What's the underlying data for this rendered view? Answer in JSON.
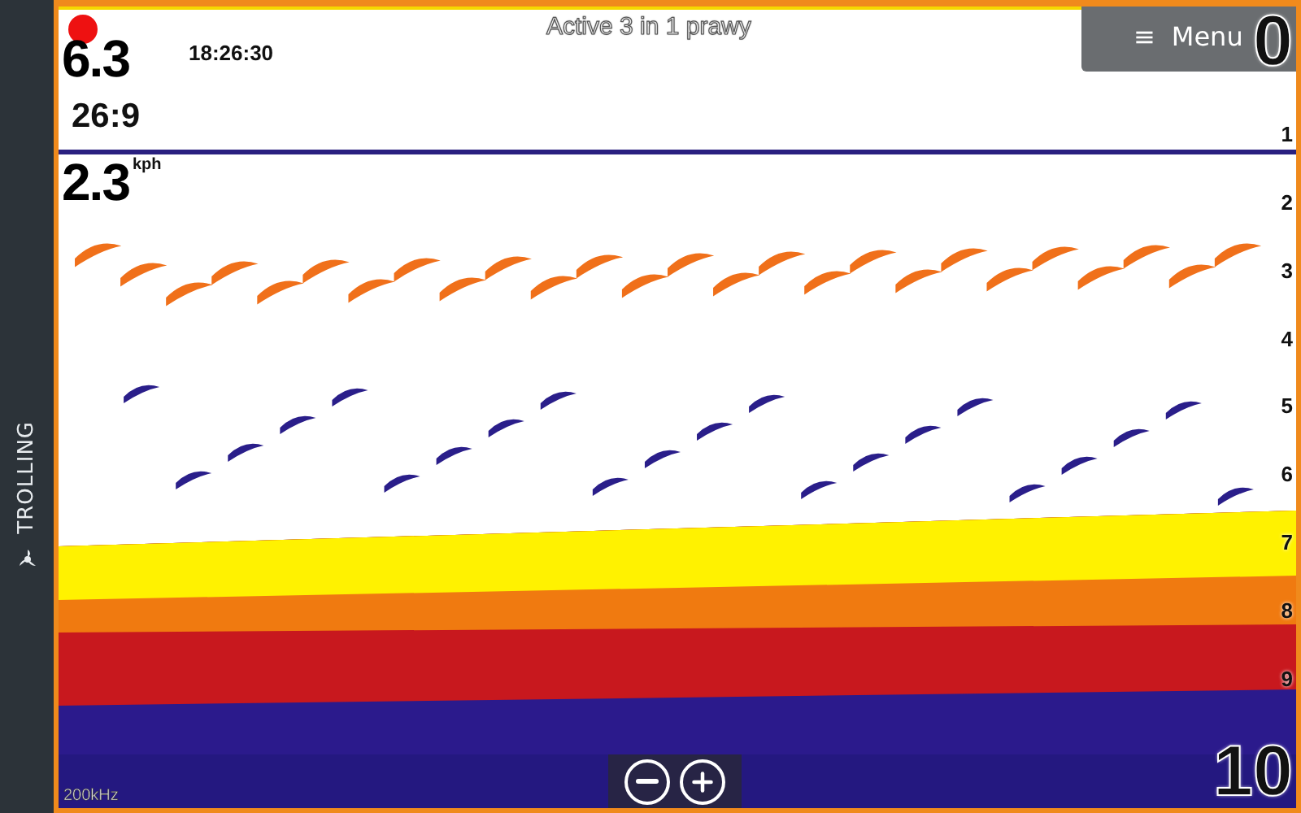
{
  "sidebar": {
    "mode_label": "TROLLING"
  },
  "title": "Active 3 in 1 prawy",
  "readings": [
    {
      "kind": "big",
      "value": "6.3"
    },
    {
      "kind": "time",
      "value": "18:26:30"
    },
    {
      "kind": "medium",
      "value": "26:9"
    },
    {
      "kind": "big",
      "value": "2.3",
      "unit": "kph"
    }
  ],
  "menu": {
    "icon": "≡",
    "label": "Menu"
  },
  "depth_scale": [
    "0",
    "1",
    "2",
    "3",
    "4",
    "5",
    "6",
    "7",
    "8",
    "9",
    "10"
  ],
  "frequency": "200kHz"
}
